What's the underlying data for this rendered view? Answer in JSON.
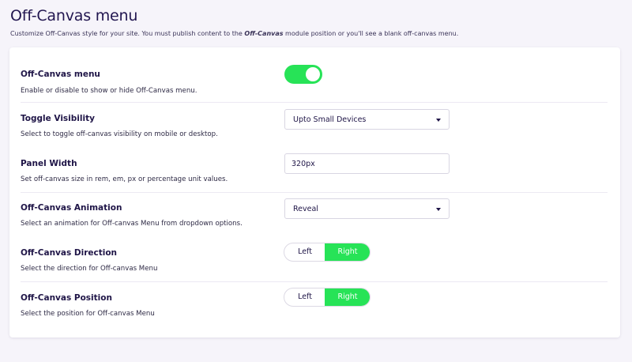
{
  "page": {
    "title": "Off-Canvas menu",
    "description_start": "Customize Off-Canvas style for your site. You must publish content to the ",
    "description_module": "Off-Canvas",
    "description_end": " module position or you'll see a blank off-canvas menu."
  },
  "settings": {
    "menu": {
      "title": "Off-Canvas menu",
      "description": "Enable or disable to show or hide Off-Canvas menu.",
      "enabled": true
    },
    "visibility": {
      "title": "Toggle Visibility",
      "description": "Select to toggle off-canvas visibility on mobile or desktop.",
      "selected": "Upto Small Devices"
    },
    "width": {
      "title": "Panel Width",
      "description": "Set off-canvas size in rem, em, px or percentage unit values.",
      "value": "320px"
    },
    "animation": {
      "title": "Off-Canvas Animation",
      "description": "Select an animation for Off-canvas Menu from dropdown options.",
      "selected": "Reveal"
    },
    "direction": {
      "title": "Off-Canvas Direction",
      "description": "Select the direction for Off-canvas Menu",
      "options": [
        "Left",
        "Right"
      ],
      "selected": "Right"
    },
    "position": {
      "title": "Off-Canvas Position",
      "description": "Select the position for Off-canvas Menu",
      "options": [
        "Left",
        "Right"
      ],
      "selected": "Right"
    }
  },
  "colors": {
    "accent": "#27e357",
    "heading": "#221650",
    "background": "#f6f4fa"
  }
}
